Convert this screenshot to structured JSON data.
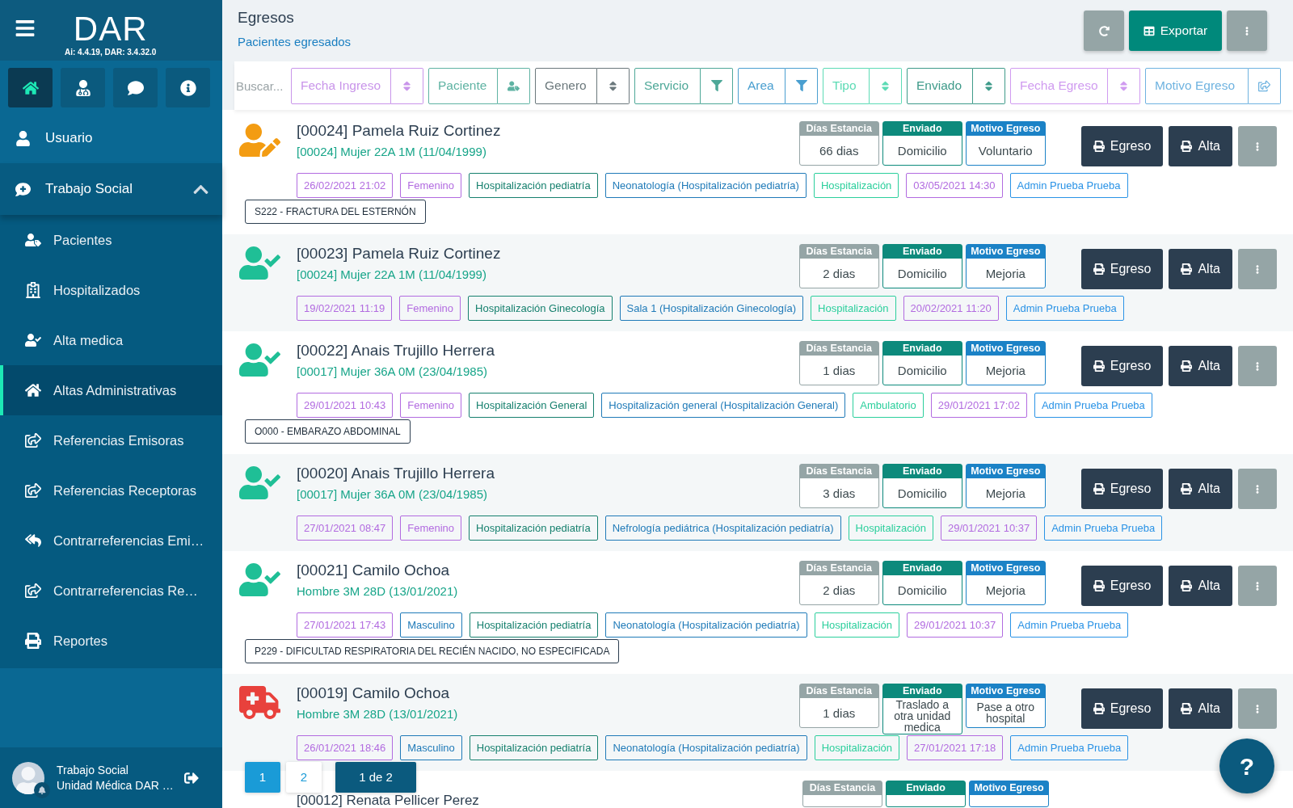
{
  "sidebar": {
    "logo": "DAR",
    "version": "Ai: 4.4.19, DAR: 3.4.32.0",
    "shortcuts": [
      {
        "kind": "home",
        "selected": true
      },
      {
        "kind": "doctor",
        "selected": false
      },
      {
        "kind": "chat",
        "selected": false
      },
      {
        "kind": "info",
        "selected": false
      }
    ],
    "user_item": {
      "kind": "user",
      "label": "Usuario"
    },
    "section": {
      "kind": "medical-chat",
      "label": "Trabajo Social",
      "expanded": true,
      "items": [
        {
          "kind": "patient",
          "label": "Pacientes",
          "selected": false
        },
        {
          "kind": "hospital",
          "label": "Hospitalizados",
          "selected": false
        },
        {
          "kind": "user-check",
          "label": "Alta medica",
          "selected": false
        },
        {
          "kind": "home",
          "label": "Altas Administrativas",
          "selected": true
        },
        {
          "kind": "share",
          "label": "Referencias Emisoras",
          "selected": false
        },
        {
          "kind": "share",
          "label": "Referencias Receptoras",
          "selected": false
        },
        {
          "kind": "reply",
          "label": "Contrarreferencias Emi…",
          "selected": false
        },
        {
          "kind": "share",
          "label": "Contrarreferencias Re…",
          "selected": false
        },
        {
          "kind": "print",
          "label": "Reportes",
          "selected": false
        }
      ]
    },
    "footer": {
      "name": "Trabajo Social",
      "unit": "Unidad Médica DAR …"
    }
  },
  "header": {
    "title": "Egresos",
    "subtitle": "Pacientes egresados",
    "actions": [
      {
        "kind": "refresh"
      },
      {
        "kind": "export",
        "label": "Exportar"
      },
      {
        "kind": "more"
      }
    ]
  },
  "filters": {
    "search": {
      "placeholder": "Buscar..."
    },
    "fields": [
      {
        "placeholder": "Fecha Ingreso",
        "kind": "sort",
        "color": "#c995ea"
      },
      {
        "placeholder": "Paciente",
        "kind": "patient",
        "color": "#5fb3a3"
      },
      {
        "placeholder": "Genero",
        "kind": "sort",
        "color": "#6b787c"
      },
      {
        "placeholder": "Servicio",
        "kind": "filter",
        "color": "#4ea898"
      },
      {
        "placeholder": "Area",
        "kind": "filter",
        "color": "#4a9fd0"
      },
      {
        "placeholder": "Tipo",
        "kind": "sort",
        "color": "#5ddbb5"
      },
      {
        "placeholder": "Enviado",
        "kind": "sort",
        "color": "#3f9b8a"
      },
      {
        "placeholder": "Fecha Egreso",
        "kind": "sort",
        "color": "#d09bf0"
      },
      {
        "placeholder": "Motivo Egreso",
        "kind": "share",
        "color": "#6fb3e0"
      }
    ]
  },
  "rows": [
    {
      "kind": "edit",
      "name": "[00024] Pamela Ruiz Cortinez",
      "subtitle": "[00024] Mujer 22A 1M (11/04/1999)",
      "stats": [
        {
          "label": "Días Estancia",
          "value": "66 dias",
          "color": "#95a5a6"
        },
        {
          "label": "Enviado",
          "value": "Domicilio",
          "color": "#0d8a7c"
        },
        {
          "label": "Motivo Egreso",
          "value": "Voluntario",
          "color": "#1b82c6"
        }
      ],
      "buttons": [
        {
          "kind": "print",
          "label": "Egreso"
        },
        {
          "kind": "print",
          "label": "Alta"
        },
        {
          "kind": "more"
        }
      ],
      "tags": [
        {
          "text": "26/02/2021 21:02",
          "color": "#b26be0"
        },
        {
          "text": "Femenino",
          "color": "#b26be0"
        },
        {
          "text": "Hospitalización pediatría",
          "color": "#16806e"
        },
        {
          "text": "Neonatología (Hospitalización pediatría)",
          "color": "#1f7ab8"
        },
        {
          "text": "Hospitalización",
          "color": "#2bcf9c"
        },
        {
          "text": "03/05/2021 14:30",
          "color": "#b26be0"
        },
        {
          "text": "Admin Prueba Prueba",
          "color": "#2a93e6"
        }
      ],
      "diagnosis": "S222 - FRACTURA DEL ESTERNÓN"
    },
    {
      "kind": "check",
      "name": "[00023] Pamela Ruiz Cortinez",
      "subtitle": "[00024] Mujer 22A 1M (11/04/1999)",
      "stats": [
        {
          "label": "Días Estancia",
          "value": "2 dias",
          "color": "#95a5a6"
        },
        {
          "label": "Enviado",
          "value": "Domicilio",
          "color": "#0d8a7c"
        },
        {
          "label": "Motivo Egreso",
          "value": "Mejoria",
          "color": "#1b82c6"
        }
      ],
      "buttons": [
        {
          "kind": "print",
          "label": "Egreso"
        },
        {
          "kind": "print",
          "label": "Alta"
        },
        {
          "kind": "more"
        }
      ],
      "tags": [
        {
          "text": "19/02/2021 11:19",
          "color": "#b26be0"
        },
        {
          "text": "Femenino",
          "color": "#b26be0"
        },
        {
          "text": "Hospitalización Ginecología",
          "color": "#16806e"
        },
        {
          "text": "Sala 1 (Hospitalización Ginecología)",
          "color": "#1f7ab8"
        },
        {
          "text": "Hospitalización",
          "color": "#2bcf9c"
        },
        {
          "text": "20/02/2021 11:20",
          "color": "#b26be0"
        },
        {
          "text": "Admin Prueba Prueba",
          "color": "#2a93e6"
        }
      ]
    },
    {
      "kind": "check",
      "name": "[00022] Anais Trujillo Herrera",
      "subtitle": "[00017] Mujer 36A 0M (23/04/1985)",
      "stats": [
        {
          "label": "Días Estancia",
          "value": "1 dias",
          "color": "#95a5a6"
        },
        {
          "label": "Enviado",
          "value": "Domicilio",
          "color": "#0d8a7c"
        },
        {
          "label": "Motivo Egreso",
          "value": "Mejoria",
          "color": "#1b82c6"
        }
      ],
      "buttons": [
        {
          "kind": "print",
          "label": "Egreso"
        },
        {
          "kind": "print",
          "label": "Alta"
        },
        {
          "kind": "more"
        }
      ],
      "tags": [
        {
          "text": "29/01/2021 10:43",
          "color": "#b26be0"
        },
        {
          "text": "Femenino",
          "color": "#b26be0"
        },
        {
          "text": "Hospitalización General",
          "color": "#16806e"
        },
        {
          "text": "Hospitalización general (Hospitalización General)",
          "color": "#1f7ab8"
        },
        {
          "text": "Ambulatorio",
          "color": "#2bcf9c"
        },
        {
          "text": "29/01/2021 17:02",
          "color": "#b26be0"
        },
        {
          "text": "Admin Prueba Prueba",
          "color": "#2a93e6"
        }
      ],
      "diagnosis": "O000 - EMBARAZO ABDOMINAL"
    },
    {
      "kind": "check",
      "name": "[00020] Anais Trujillo Herrera",
      "subtitle": "[00017] Mujer 36A 0M (23/04/1985)",
      "stats": [
        {
          "label": "Días Estancia",
          "value": "3 dias",
          "color": "#95a5a6"
        },
        {
          "label": "Enviado",
          "value": "Domicilio",
          "color": "#0d8a7c"
        },
        {
          "label": "Motivo Egreso",
          "value": "Mejoria",
          "color": "#1b82c6"
        }
      ],
      "buttons": [
        {
          "kind": "print",
          "label": "Egreso"
        },
        {
          "kind": "print",
          "label": "Alta"
        },
        {
          "kind": "more"
        }
      ],
      "tags": [
        {
          "text": "27/01/2021 08:47",
          "color": "#b26be0"
        },
        {
          "text": "Femenino",
          "color": "#b26be0"
        },
        {
          "text": "Hospitalización pediatría",
          "color": "#16806e"
        },
        {
          "text": "Nefrología pediátrica (Hospitalización pediatría)",
          "color": "#1f7ab8"
        },
        {
          "text": "Hospitalización",
          "color": "#2bcf9c"
        },
        {
          "text": "29/01/2021 10:37",
          "color": "#b26be0"
        },
        {
          "text": "Admin Prueba Prueba",
          "color": "#2a93e6"
        }
      ]
    },
    {
      "kind": "check",
      "name": "[00021] Camilo Ochoa",
      "subtitle": "Hombre 3M 28D (13/01/2021)",
      "stats": [
        {
          "label": "Días Estancia",
          "value": "2 dias",
          "color": "#95a5a6"
        },
        {
          "label": "Enviado",
          "value": "Domicilio",
          "color": "#0d8a7c"
        },
        {
          "label": "Motivo Egreso",
          "value": "Mejoria",
          "color": "#1b82c6"
        }
      ],
      "buttons": [
        {
          "kind": "print",
          "label": "Egreso"
        },
        {
          "kind": "print",
          "label": "Alta"
        },
        {
          "kind": "more"
        }
      ],
      "tags": [
        {
          "text": "27/01/2021 17:43",
          "color": "#b26be0"
        },
        {
          "text": "Masculino",
          "color": "#1f7ab8"
        },
        {
          "text": "Hospitalización pediatría",
          "color": "#16806e"
        },
        {
          "text": "Neonatología (Hospitalización pediatría)",
          "color": "#1f7ab8"
        },
        {
          "text": "Hospitalización",
          "color": "#2bcf9c"
        },
        {
          "text": "29/01/2021 10:37",
          "color": "#b26be0"
        },
        {
          "text": "Admin Prueba Prueba",
          "color": "#2a93e6"
        }
      ],
      "diagnosis": "P229 - DIFICULTAD RESPIRATORIA DEL RECIÉN NACIDO, NO ESPECIFICADA"
    },
    {
      "kind": "ambulance",
      "name": "[00019] Camilo Ochoa",
      "subtitle": "Hombre 3M 28D (13/01/2021)",
      "stats": [
        {
          "label": "Días Estancia",
          "value": "1 dias",
          "color": "#95a5a6"
        },
        {
          "label": "Enviado",
          "value": "Traslado a otra unidad medica",
          "color": "#0d8a7c"
        },
        {
          "label": "Motivo Egreso",
          "value": "Pase a otro hospital",
          "color": "#1b82c6"
        }
      ],
      "buttons": [
        {
          "kind": "print",
          "label": "Egreso"
        },
        {
          "kind": "print",
          "label": "Alta"
        },
        {
          "kind": "more"
        }
      ],
      "tags": [
        {
          "text": "26/01/2021 18:46",
          "color": "#b26be0"
        },
        {
          "text": "Masculino",
          "color": "#1f7ab8"
        },
        {
          "text": "Hospitalización pediatría",
          "color": "#16806e"
        },
        {
          "text": "Neonatología (Hospitalización pediatría)",
          "color": "#1f7ab8"
        },
        {
          "text": "Hospitalización",
          "color": "#2bcf9c"
        },
        {
          "text": "27/01/2021 17:18",
          "color": "#b26be0"
        },
        {
          "text": "Admin Prueba Prueba",
          "color": "#2a93e6"
        }
      ]
    }
  ],
  "partial_row": {
    "name": "[00012] Renata Pellicer Perez",
    "stats": [
      {
        "label": "Días Estancia",
        "color": "#95a5a6"
      },
      {
        "label": "Enviado",
        "color": "#0d8a7c"
      },
      {
        "label": "Motivo Egreso",
        "color": "#1b82c6"
      }
    ]
  },
  "pagination": {
    "pages": [
      {
        "label": "1",
        "selected": true
      },
      {
        "label": "2",
        "selected": false
      }
    ],
    "summary": "1 de 2"
  },
  "help": {
    "label": "?"
  }
}
